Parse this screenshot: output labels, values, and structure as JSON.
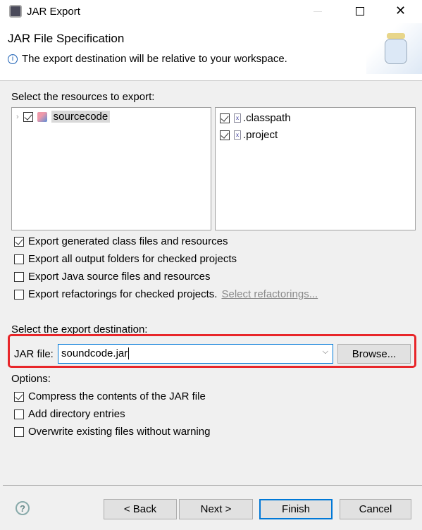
{
  "window": {
    "title": "JAR Export"
  },
  "header": {
    "title": "JAR File Specification",
    "message": "The export destination will be relative to your workspace."
  },
  "resources": {
    "label": "Select the resources to export:",
    "tree": [
      {
        "label": "sourcecode",
        "checked": true
      }
    ],
    "files": [
      {
        "label": ".classpath",
        "checked": true
      },
      {
        "label": ".project",
        "checked": true
      }
    ]
  },
  "export_options": [
    {
      "label": "Export generated class files and resources",
      "checked": true
    },
    {
      "label": "Export all output folders for checked projects",
      "checked": false
    },
    {
      "label": "Export Java source files and resources",
      "checked": false
    },
    {
      "label": "Export refactorings for checked projects.",
      "checked": false
    }
  ],
  "select_refactorings_link": "Select refactorings...",
  "destination": {
    "label": "Select the export destination:",
    "jar_label": "JAR file:",
    "jar_value": "soundcode.jar",
    "browse": "Browse..."
  },
  "options": {
    "label": "Options:",
    "items": [
      {
        "label": "Compress the contents of the JAR file",
        "checked": true
      },
      {
        "label": "Add directory entries",
        "checked": false
      },
      {
        "label": "Overwrite existing files without warning",
        "checked": false
      }
    ]
  },
  "footer": {
    "back": "< Back",
    "next": "Next >",
    "finish": "Finish",
    "cancel": "Cancel"
  },
  "colors": {
    "highlight": "#e8262a",
    "accent": "#0078d7"
  }
}
